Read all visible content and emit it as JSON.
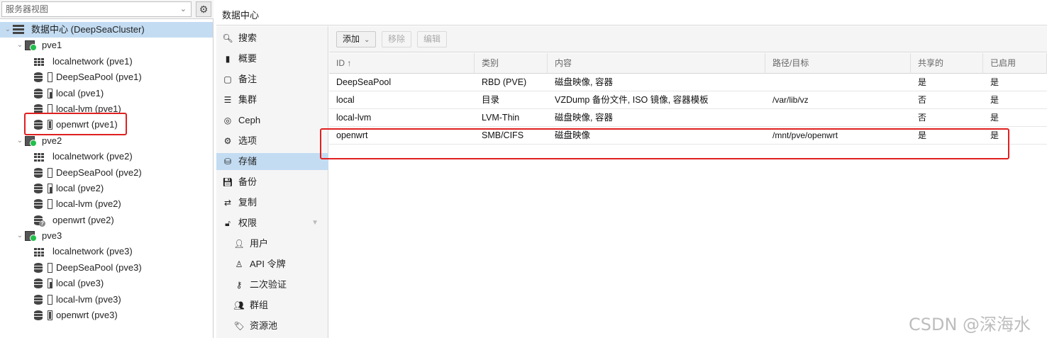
{
  "view_selector": {
    "value": "服务器视图"
  },
  "tree": [
    {
      "label": "数据中心 (DeepSeaCluster)",
      "icon": "datacenter-icon",
      "indent": 0,
      "expand": "⌄",
      "selected": true
    },
    {
      "label": "pve1",
      "icon": "node-online-icon",
      "indent": 1,
      "expand": "⌄"
    },
    {
      "label": "localnetwork (pve1)",
      "icon": "sdn-grid-icon",
      "indent": 2
    },
    {
      "label": "DeepSeaPool (pve1)",
      "icon": "storage-empty-icon",
      "indent": 2
    },
    {
      "label": "local (pve1)",
      "icon": "storage-partial-icon",
      "indent": 2
    },
    {
      "label": "local-lvm (pve1)",
      "icon": "storage-empty-icon",
      "indent": 2
    },
    {
      "label": "openwrt (pve1)",
      "icon": "storage-full-icon",
      "indent": 2
    },
    {
      "label": "pve2",
      "icon": "node-online-icon",
      "indent": 1,
      "expand": "⌄"
    },
    {
      "label": "localnetwork (pve2)",
      "icon": "sdn-grid-icon",
      "indent": 2
    },
    {
      "label": "DeepSeaPool (pve2)",
      "icon": "storage-empty-icon",
      "indent": 2
    },
    {
      "label": "local (pve2)",
      "icon": "storage-partial-icon",
      "indent": 2
    },
    {
      "label": "local-lvm (pve2)",
      "icon": "storage-empty-icon",
      "indent": 2
    },
    {
      "label": "openwrt (pve2)",
      "icon": "storage-unknown-icon",
      "indent": 2
    },
    {
      "label": "pve3",
      "icon": "node-online-icon",
      "indent": 1,
      "expand": "⌄"
    },
    {
      "label": "localnetwork (pve3)",
      "icon": "sdn-grid-icon",
      "indent": 2
    },
    {
      "label": "DeepSeaPool (pve3)",
      "icon": "storage-empty-icon",
      "indent": 2
    },
    {
      "label": "local (pve3)",
      "icon": "storage-partial-icon",
      "indent": 2
    },
    {
      "label": "local-lvm (pve3)",
      "icon": "storage-empty-icon",
      "indent": 2
    },
    {
      "label": "openwrt (pve3)",
      "icon": "storage-full-icon",
      "indent": 2
    }
  ],
  "header": {
    "title": "数据中心"
  },
  "nav": [
    {
      "label": "搜索",
      "icon": "search-icon",
      "glyph": "🔍︎",
      "sub": false
    },
    {
      "label": "概要",
      "icon": "book-icon",
      "glyph": "▮",
      "sub": false
    },
    {
      "label": "备注",
      "icon": "note-icon",
      "glyph": "▢",
      "sub": false
    },
    {
      "label": "集群",
      "icon": "server-icon",
      "glyph": "☰",
      "sub": false
    },
    {
      "label": "Ceph",
      "icon": "ceph-icon",
      "glyph": "◎",
      "sub": false
    },
    {
      "label": "选项",
      "icon": "gear-icon",
      "glyph": "⚙",
      "sub": false
    },
    {
      "label": "存储",
      "icon": "database-icon",
      "glyph": "⛁",
      "sub": false,
      "selected": true
    },
    {
      "label": "备份",
      "icon": "floppy-icon",
      "glyph": "💾︎",
      "sub": false
    },
    {
      "label": "复制",
      "icon": "retweet-icon",
      "glyph": "⇄",
      "sub": false
    },
    {
      "label": "权限",
      "icon": "unlock-icon",
      "glyph": "🔓︎",
      "sub": false,
      "collapse": "▼"
    },
    {
      "label": "用户",
      "icon": "user-icon",
      "glyph": "👤︎",
      "sub": true
    },
    {
      "label": "API 令牌",
      "icon": "user-outline-icon",
      "glyph": "♙",
      "sub": true
    },
    {
      "label": "二次验证",
      "icon": "key-icon",
      "glyph": "⚷",
      "sub": true
    },
    {
      "label": "群组",
      "icon": "users-icon",
      "glyph": "👥︎",
      "sub": true
    },
    {
      "label": "资源池",
      "icon": "tags-icon",
      "glyph": "🏷︎",
      "sub": true
    }
  ],
  "toolbar": {
    "add_label": "添加",
    "remove_label": "移除",
    "edit_label": "编辑"
  },
  "grid": {
    "columns": [
      "ID ↑",
      "类别",
      "内容",
      "路径/目标",
      "共享的",
      "已启用"
    ],
    "rows": [
      [
        "DeepSeaPool",
        "RBD (PVE)",
        "磁盘映像, 容器",
        "",
        "是",
        "是"
      ],
      [
        "local",
        "目录",
        "VZDump 备份文件, ISO 镜像, 容器模板",
        "/var/lib/vz",
        "否",
        "是"
      ],
      [
        "local-lvm",
        "LVM-Thin",
        "磁盘映像, 容器",
        "",
        "否",
        "是"
      ],
      [
        "openwrt",
        "SMB/CIFS",
        "磁盘映像",
        "/mnt/pve/openwrt",
        "是",
        "是"
      ]
    ]
  },
  "watermark": "CSDN @深海水",
  "colors": {
    "selection": "#c3dcf2",
    "highlight": "#e02020",
    "online": "#21bf4b"
  }
}
